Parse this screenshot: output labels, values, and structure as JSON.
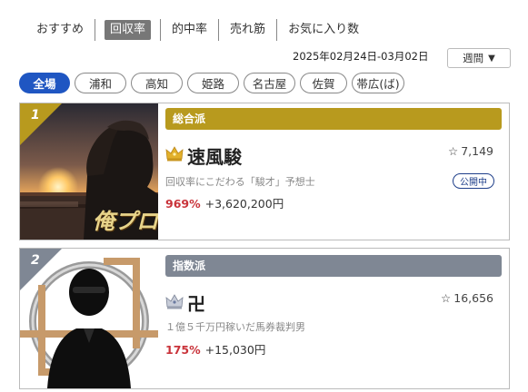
{
  "tabs": [
    {
      "label": "おすすめ",
      "active": false
    },
    {
      "label": "回収率",
      "active": true
    },
    {
      "label": "的中率",
      "active": false
    },
    {
      "label": "売れ筋",
      "active": false
    },
    {
      "label": "お気に入り数",
      "active": false
    }
  ],
  "date_range": "2025年02月24日-03月02日",
  "period_select": {
    "value": "週間",
    "icon": "caret-down-icon"
  },
  "venues": [
    {
      "label": "全場",
      "active": true
    },
    {
      "label": "浦和",
      "active": false
    },
    {
      "label": "高知",
      "active": false
    },
    {
      "label": "姫路",
      "active": false
    },
    {
      "label": "名古屋",
      "active": false
    },
    {
      "label": "佐賀",
      "active": false
    },
    {
      "label": "帯広(ば)",
      "active": false
    }
  ],
  "cards": [
    {
      "rank": "1",
      "style_label": "総合派",
      "style_color": "#b89a1e",
      "crown": "gold-crown-icon",
      "name": "速風駿",
      "favorites": "7,149",
      "tagline": "回収率にこだわる「駿才」予想士",
      "public_badge": "公開中",
      "return_rate": "969%",
      "profit": "+3,620,200円",
      "thumb_logo_text": "俺プロ"
    },
    {
      "rank": "2",
      "style_label": "指数派",
      "style_color": "#7f8794",
      "crown": "silver-crown-icon",
      "name": "卍",
      "favorites": "16,656",
      "tagline": "１億５千万円稼いだ馬券裁判男",
      "return_rate": "175%",
      "profit": "+15,030円"
    }
  ],
  "colors": {
    "accent": "#1f56c2",
    "rate": "#c9333a",
    "badge": "#1f3f8a"
  }
}
